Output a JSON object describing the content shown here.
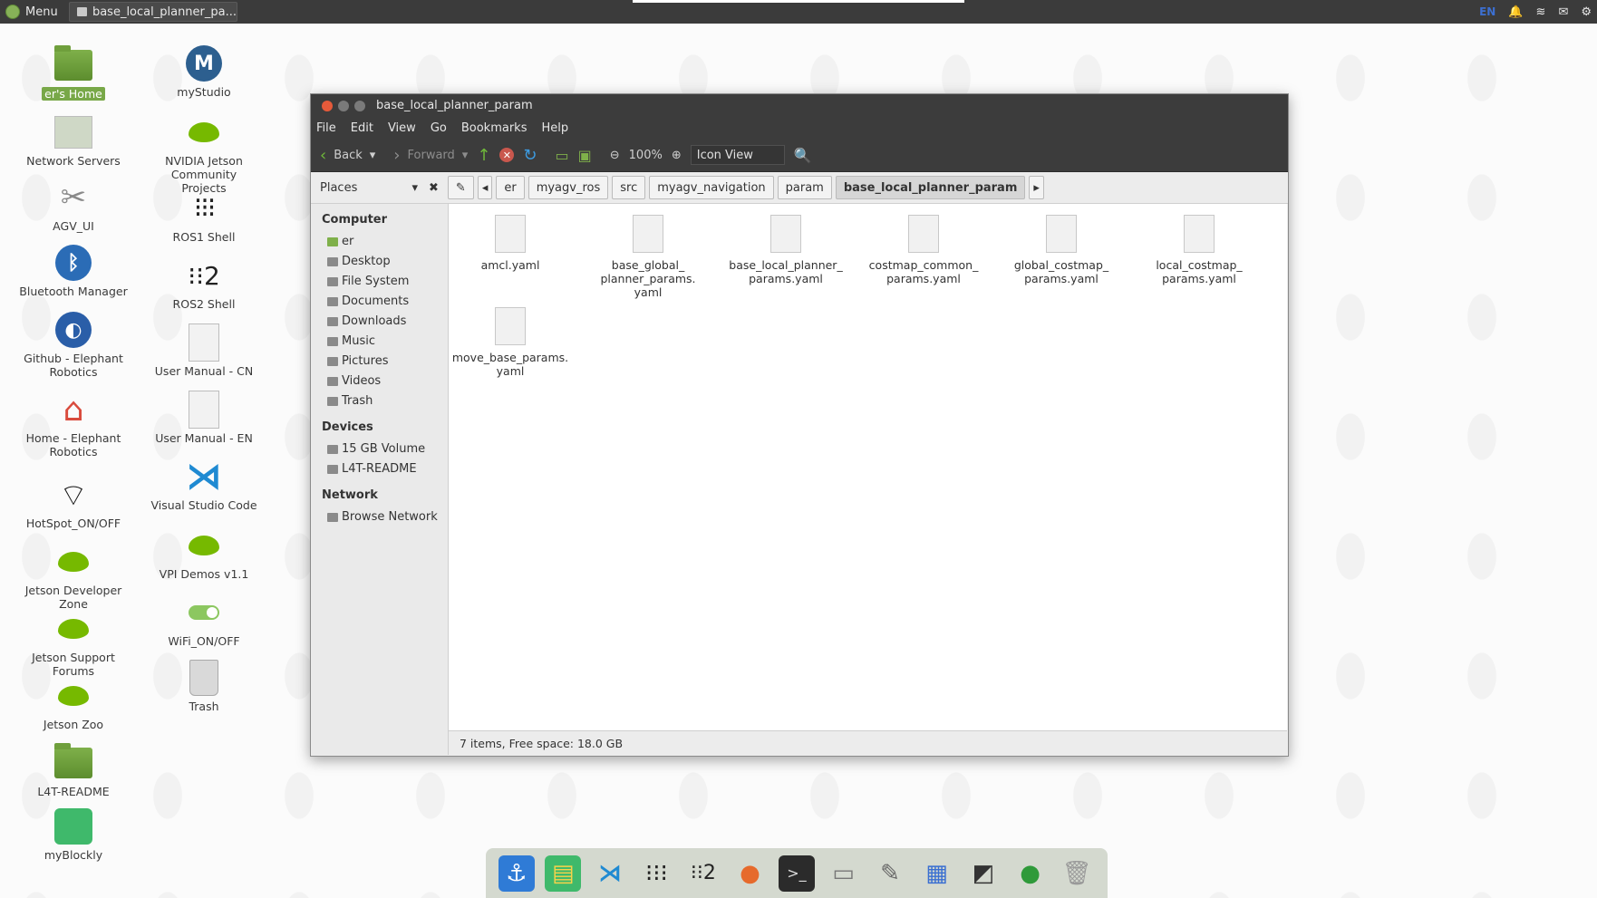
{
  "top_panel": {
    "menu_label": "Menu",
    "task_label": "base_local_planner_pa...",
    "lang": "EN"
  },
  "desktop": {
    "col1": [
      {
        "label": "er's Home",
        "icon": "home-folder-icon"
      },
      {
        "label": "Network Servers",
        "icon": "network-icon"
      },
      {
        "label": "AGV_UI",
        "icon": "tools-icon"
      },
      {
        "label": "Bluetooth Manager",
        "icon": "bluetooth-icon"
      },
      {
        "label": "Github - Elephant Robotics",
        "icon": "globe-icon"
      },
      {
        "label": "Home - Elephant Robotics",
        "icon": "house-icon"
      },
      {
        "label": "HotSpot_ON/OFF",
        "icon": "wifi-icon"
      },
      {
        "label": "Jetson Developer Zone",
        "icon": "nvidia-icon"
      },
      {
        "label": "Jetson Support Forums",
        "icon": "nvidia-icon"
      },
      {
        "label": "Jetson Zoo",
        "icon": "nvidia-icon"
      },
      {
        "label": "L4T-README",
        "icon": "folder-icon"
      },
      {
        "label": "myBlockly",
        "icon": "blockly-icon"
      }
    ],
    "col2": [
      {
        "label": "myStudio",
        "icon": "mystudio-icon"
      },
      {
        "label": "NVIDIA Jetson Community Projects",
        "icon": "nvidia-icon"
      },
      {
        "label": "ROS1 Shell",
        "icon": "ros-icon"
      },
      {
        "label": "ROS2 Shell",
        "icon": "ros2-icon"
      },
      {
        "label": "User Manual - CN",
        "icon": "document-icon"
      },
      {
        "label": "User Manual - EN",
        "icon": "document-icon"
      },
      {
        "label": "Visual Studio Code",
        "icon": "vscode-icon"
      },
      {
        "label": "VPI Demos v1.1",
        "icon": "nvidia-icon"
      },
      {
        "label": "WiFi_ON/OFF",
        "icon": "toggle-icon"
      },
      {
        "label": "Trash",
        "icon": "trash-icon"
      }
    ]
  },
  "window": {
    "title": "base_local_planner_param",
    "menu": [
      "File",
      "Edit",
      "View",
      "Go",
      "Bookmarks",
      "Help"
    ],
    "toolbar": {
      "back": "Back",
      "forward": "Forward",
      "zoom": "100%",
      "view_mode": "Icon View"
    },
    "places_label": "Places",
    "breadcrumbs": [
      "er",
      "myagv_ros",
      "src",
      "myagv_navigation",
      "param",
      "base_local_planner_param"
    ],
    "sidebar": {
      "computer_header": "Computer",
      "computer_items": [
        "er",
        "Desktop",
        "File System",
        "Documents",
        "Downloads",
        "Music",
        "Pictures",
        "Videos",
        "Trash"
      ],
      "devices_header": "Devices",
      "device_items": [
        "15 GB Volume",
        "L4T-README"
      ],
      "network_header": "Network",
      "network_items": [
        "Browse Network"
      ]
    },
    "files": [
      "amcl.yaml",
      "base_global_ planner_params. yaml",
      "base_local_planner_ params.yaml",
      "costmap_common_ params.yaml",
      "global_costmap_ params.yaml",
      "local_costmap_ params.yaml",
      "move_base_params. yaml"
    ],
    "status": "7 items, Free space: 18.0 GB"
  },
  "dock": {
    "items": [
      "anchor-icon",
      "blockly-icon",
      "vscode-icon",
      "ros-icon",
      "ros2-icon",
      "firefox-icon",
      "terminal-icon",
      "files-icon",
      "text-editor-icon",
      "switcher-icon",
      "screen-icon",
      "green-circle-icon",
      "trash-icon"
    ]
  }
}
